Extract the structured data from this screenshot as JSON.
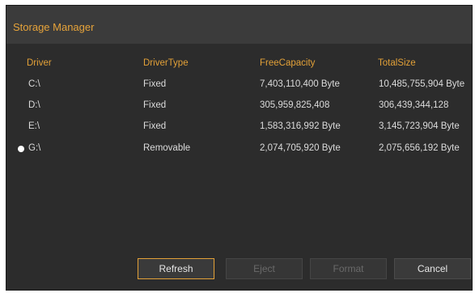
{
  "window": {
    "title": "Storage Manager"
  },
  "columns": [
    "Driver",
    "DriverType",
    "FreeCapacity",
    "TotalSize"
  ],
  "drives": [
    {
      "driver": "C:\\",
      "type": "Fixed",
      "free": "7,403,110,400 Byte",
      "total": "10,485,755,904 Byte",
      "selected": false
    },
    {
      "driver": "D:\\",
      "type": "Fixed",
      "free": "305,959,825,408",
      "total": "306,439,344,128",
      "selected": false
    },
    {
      "driver": "E:\\",
      "type": "Fixed",
      "free": "1,583,316,992 Byte",
      "total": "3,145,723,904 Byte",
      "selected": false
    },
    {
      "driver": "G:\\",
      "type": "Removable",
      "free": "2,074,705,920 Byte",
      "total": "2,075,656,192 Byte",
      "selected": true
    }
  ],
  "buttons": {
    "refresh": "Refresh",
    "eject": "Eject",
    "format": "Format",
    "cancel": "Cancel"
  },
  "colors": {
    "accent": "#e3a138",
    "background": "#2c2c2c",
    "titlebar": "#3b3b3b"
  }
}
